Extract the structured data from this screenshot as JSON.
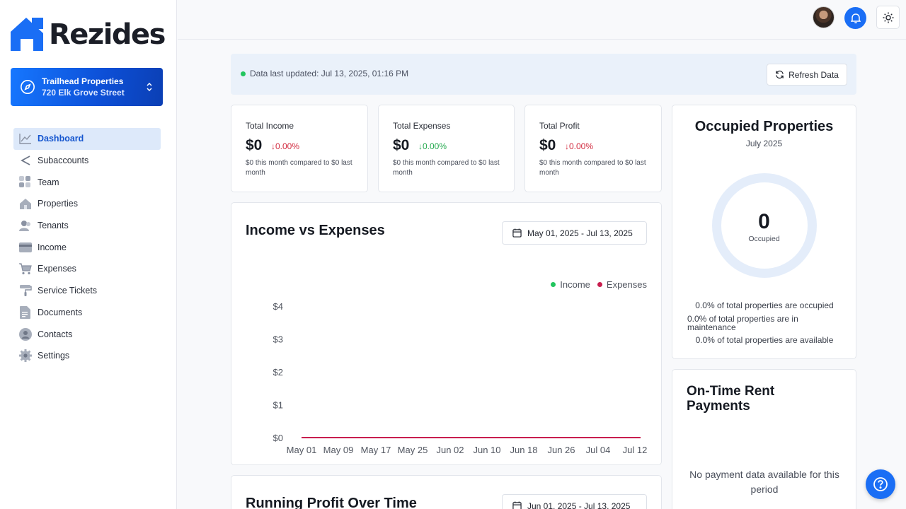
{
  "app": {
    "name": "Rezides"
  },
  "property_switcher": {
    "name": "Trailhead Properties",
    "address": "720 Elk Grove Street"
  },
  "sidebar": {
    "items": [
      {
        "label": "Dashboard",
        "icon": "chart-line-icon",
        "active": true
      },
      {
        "label": "Subaccounts",
        "icon": "share-icon"
      },
      {
        "label": "Team",
        "icon": "grid-icon"
      },
      {
        "label": "Properties",
        "icon": "house-icon"
      },
      {
        "label": "Tenants",
        "icon": "people-icon"
      },
      {
        "label": "Income",
        "icon": "credit-card-icon"
      },
      {
        "label": "Expenses",
        "icon": "cart-icon"
      },
      {
        "label": "Service Tickets",
        "icon": "paint-roller-icon"
      },
      {
        "label": "Documents",
        "icon": "document-icon"
      },
      {
        "label": "Contacts",
        "icon": "contact-icon"
      },
      {
        "label": "Settings",
        "icon": "gear-icon"
      }
    ]
  },
  "topbar": {
    "avatar": "user-avatar",
    "bell": "bell-icon",
    "theme": "sun-icon"
  },
  "update": {
    "text": "Data last updated: Jul 13, 2025, 01:16 PM",
    "refresh_label": "Refresh Data"
  },
  "stats": [
    {
      "title": "Total Income",
      "value": "$0",
      "change": "0.00%",
      "direction": "down",
      "color": "#d1293d",
      "desc": "$0 this month compared to $0 last month"
    },
    {
      "title": "Total Expenses",
      "value": "$0",
      "change": "0.00%",
      "direction": "down",
      "color": "#22a94d",
      "desc": "$0 this month compared to $0 last month"
    },
    {
      "title": "Total Profit",
      "value": "$0",
      "change": "0.00%",
      "direction": "down",
      "color": "#d1293d",
      "desc": "$0 this month compared to $0 last month"
    }
  ],
  "income_chart": {
    "title": "Income vs Expenses",
    "date_range": "May 01, 2025 - Jul 13, 2025"
  },
  "chart_data": {
    "type": "line",
    "x": [
      "May 01",
      "May 09",
      "May 17",
      "May 25",
      "Jun 02",
      "Jun 10",
      "Jun 18",
      "Jun 26",
      "Jul 04",
      "Jul 12"
    ],
    "series": [
      {
        "name": "Income",
        "color": "#22c55e",
        "values": [
          0,
          0,
          0,
          0,
          0,
          0,
          0,
          0,
          0,
          0
        ]
      },
      {
        "name": "Expenses",
        "color": "#c81e4e",
        "values": [
          0,
          0,
          0,
          0,
          0,
          0,
          0,
          0,
          0,
          0
        ]
      }
    ],
    "y_ticks": [
      "$0",
      "$1",
      "$2",
      "$3",
      "$4"
    ],
    "ylim": [
      0,
      4
    ],
    "legend": "top-right"
  },
  "occupied": {
    "title": "Occupied Properties",
    "month": "July 2025",
    "count": "0",
    "count_label": "Occupied",
    "lines": [
      "0.0% of total properties are occupied",
      "0.0% of total properties are in maintenance",
      "0.0% of total properties are available"
    ]
  },
  "rent": {
    "title": "On-Time Rent Payments",
    "empty": "No payment data available for this period"
  },
  "profit_chart": {
    "title": "Running Profit Over Time",
    "date_range": "Jun 01, 2025 - Jul 13, 2025"
  },
  "colors": {
    "accent": "#1a6ef5",
    "income": "#22c55e",
    "expenses": "#c81e4e"
  }
}
